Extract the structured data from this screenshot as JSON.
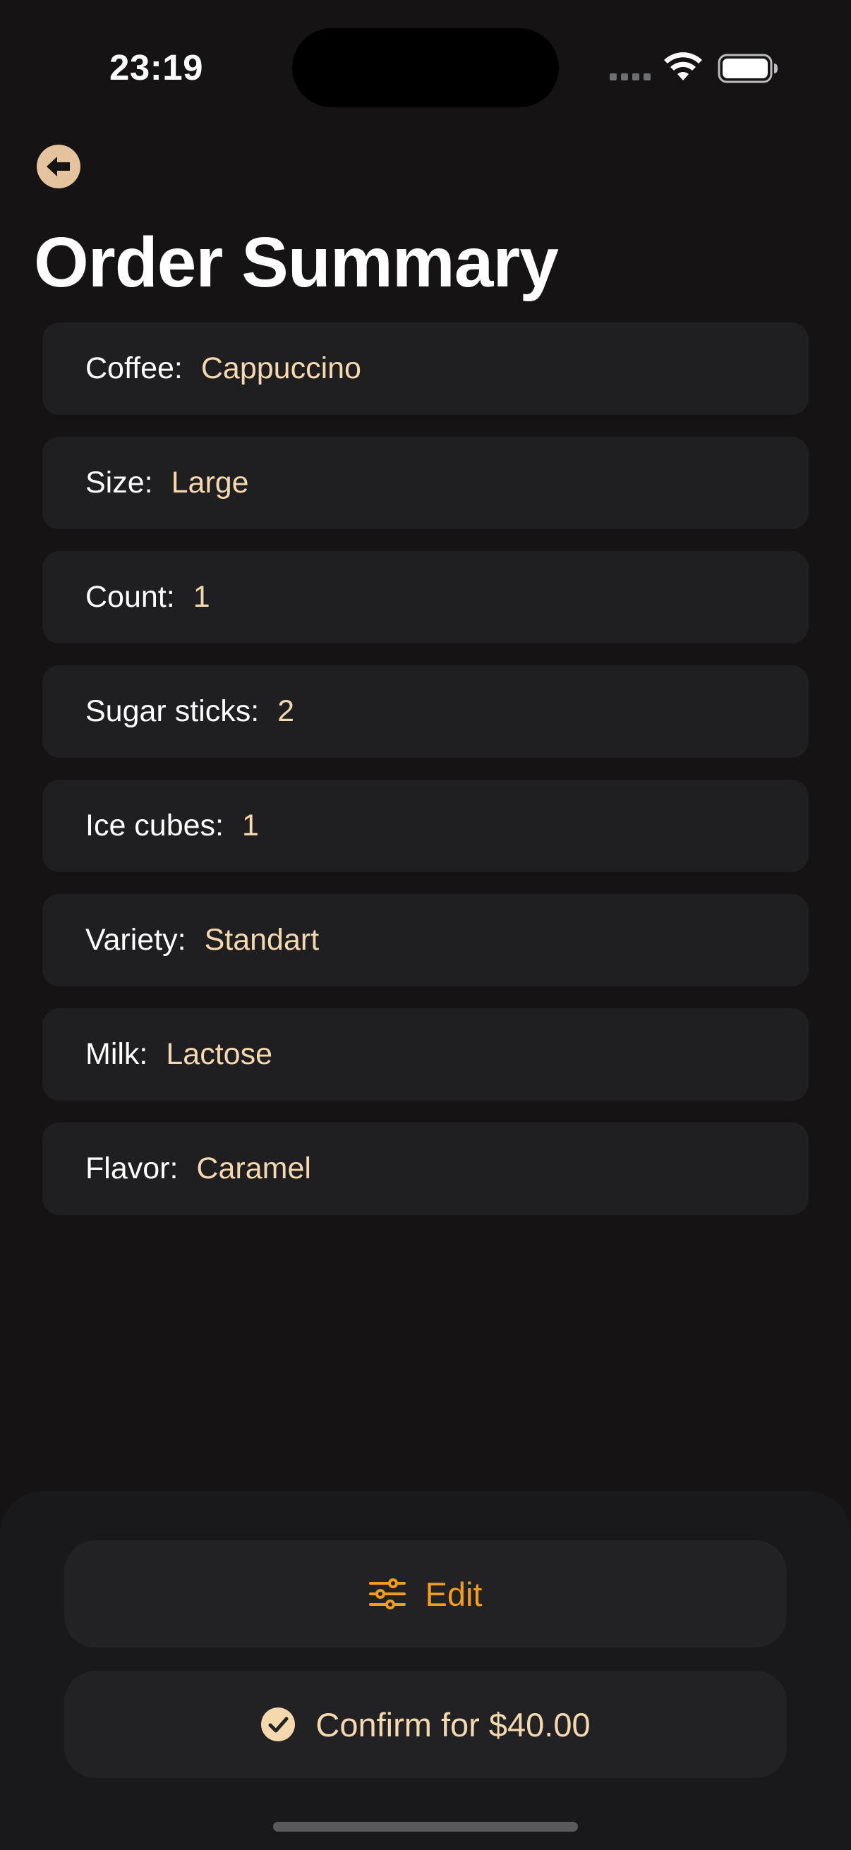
{
  "status_bar": {
    "time": "23:19",
    "icons": [
      "signal-icon",
      "wifi-icon",
      "battery-icon"
    ]
  },
  "nav": {
    "back_icon": "arrow-left-circle-icon"
  },
  "page": {
    "title": "Order Summary"
  },
  "order": {
    "items": [
      {
        "label": "Coffee:",
        "value": "Cappuccino"
      },
      {
        "label": "Size:",
        "value": "Large"
      },
      {
        "label": "Count:",
        "value": "1"
      },
      {
        "label": "Sugar sticks:",
        "value": "2"
      },
      {
        "label": "Ice cubes:",
        "value": "1"
      },
      {
        "label": "Variety:",
        "value": "Standart"
      },
      {
        "label": "Milk:",
        "value": "Lactose"
      },
      {
        "label": "Flavor:",
        "value": "Caramel"
      }
    ]
  },
  "actions": {
    "edit_label": "Edit",
    "edit_icon": "sliders-icon",
    "confirm_label": "Confirm for $40.00",
    "confirm_icon": "checkmark-circle-icon"
  },
  "colors": {
    "background": "#151314",
    "row_background": "#1f1e20",
    "value_text": "#f5d9ae",
    "edit_accent": "#f39c1e",
    "back_button": "#e6c39f"
  }
}
